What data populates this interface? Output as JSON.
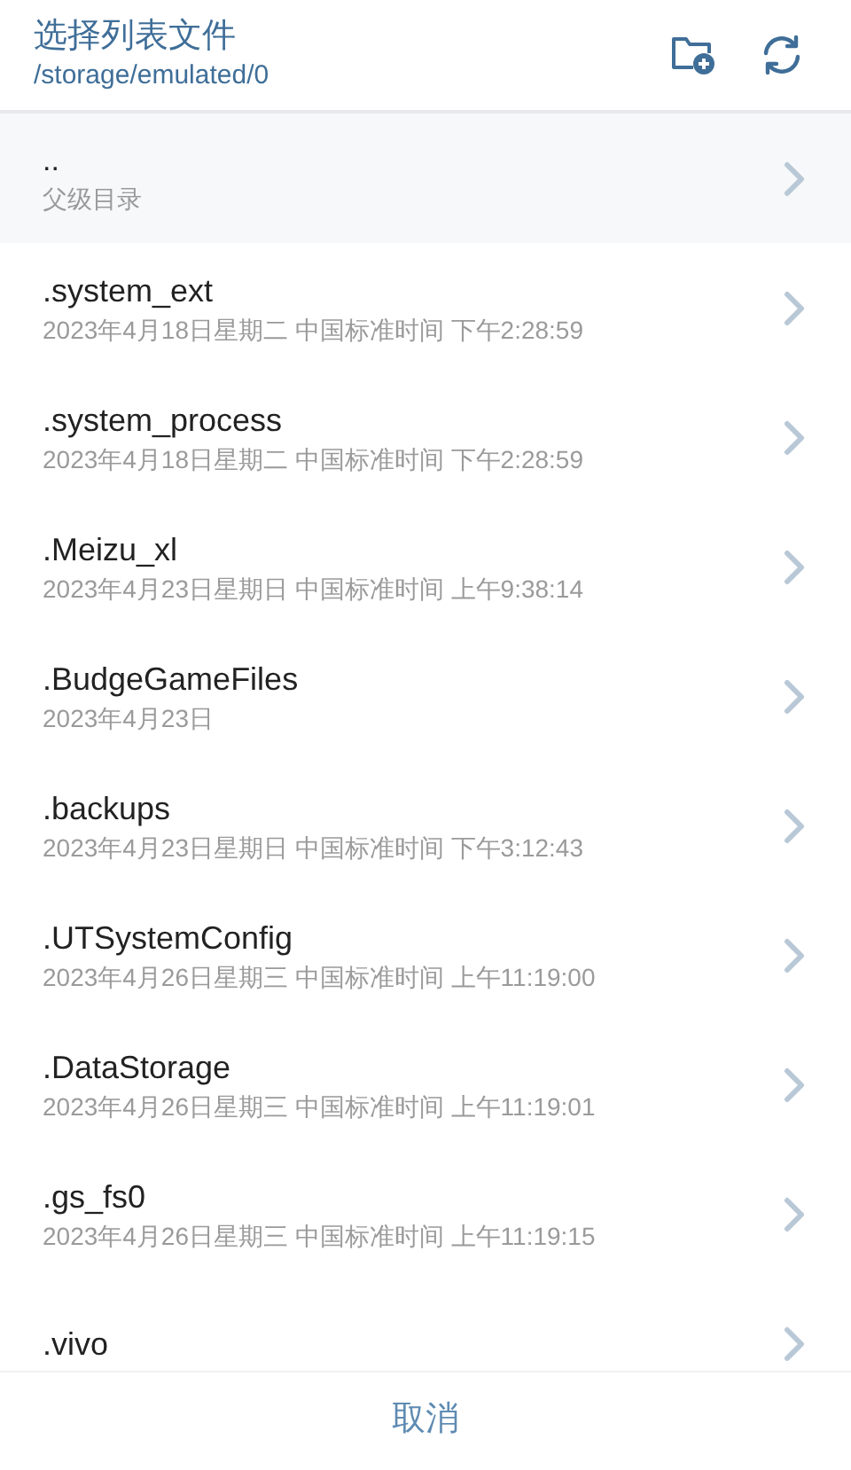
{
  "header": {
    "title": "选择列表文件",
    "path": "/storage/emulated/0"
  },
  "parent": {
    "name": "..",
    "label": "父级目录"
  },
  "items": [
    {
      "name": ".system_ext",
      "date": "2023年4月18日星期二 中国标准时间 下午2:28:59"
    },
    {
      "name": ".system_process",
      "date": "2023年4月18日星期二 中国标准时间 下午2:28:59"
    },
    {
      "name": ".Meizu_xl",
      "date": "2023年4月23日星期日 中国标准时间 上午9:38:14"
    },
    {
      "name": ".BudgeGameFiles",
      "date": "2023年4月23日"
    },
    {
      "name": ".backups",
      "date": "2023年4月23日星期日 中国标准时间 下午3:12:43"
    },
    {
      "name": ".UTSystemConfig",
      "date": "2023年4月26日星期三 中国标准时间 上午11:19:00"
    },
    {
      "name": ".DataStorage",
      "date": "2023年4月26日星期三 中国标准时间 上午11:19:01"
    },
    {
      "name": ".gs_fs0",
      "date": "2023年4月26日星期三 中国标准时间 上午11:19:15"
    },
    {
      "name": ".vivo"
    }
  ],
  "footer": {
    "cancel": "取消"
  }
}
